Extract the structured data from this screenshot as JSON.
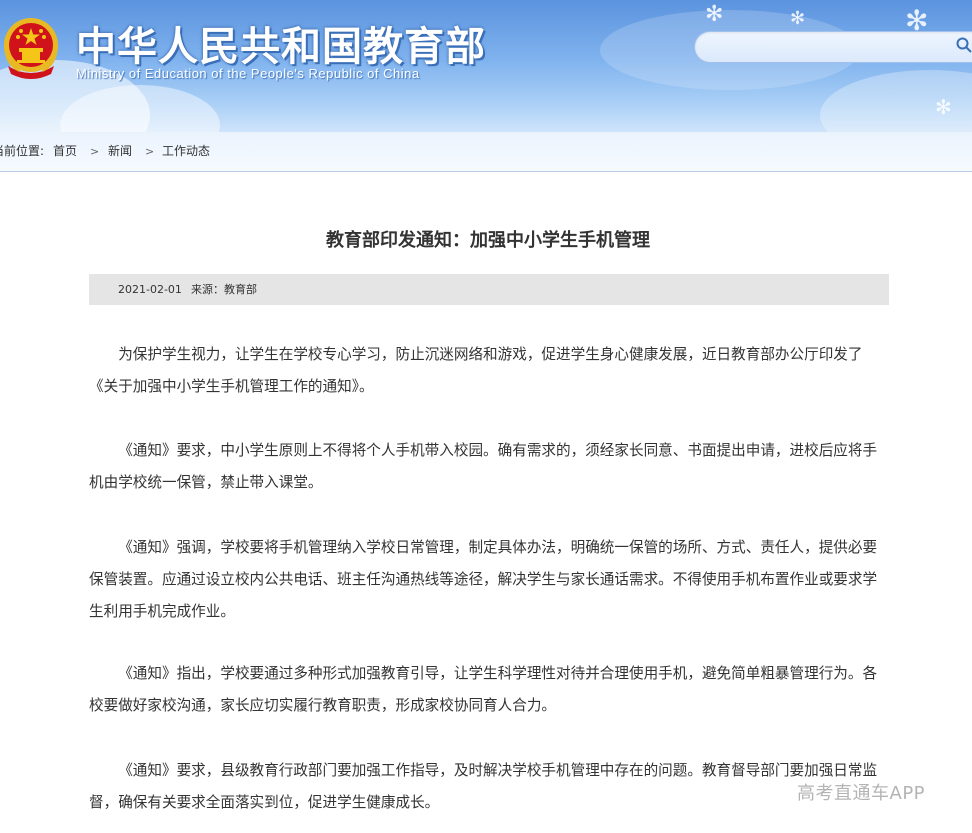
{
  "header": {
    "title": "中华人民共和国教育部",
    "subtitle": "Ministry of Education of the People's Republic of China",
    "emblem_icon": "national-emblem-icon",
    "search": {
      "placeholder": "",
      "icon": "search-icon"
    }
  },
  "breadcrumb": {
    "label": "当前位置:",
    "items": [
      "首页",
      "新闻",
      "工作动态"
    ],
    "separator": ">"
  },
  "article": {
    "title": "教育部印发通知：加强中小学生手机管理",
    "date": "2021-02-01",
    "source": "来源：教育部",
    "paragraphs": [
      "为保护学生视力，让学生在学校专心学习，防止沉迷网络和游戏，促进学生身心健康发展，近日教育部办公厅印发了《关于加强中小学生手机管理工作的通知》。",
      "《通知》要求，中小学生原则上不得将个人手机带入校园。确有需求的，须经家长同意、书面提出申请，进校后应将手机由学校统一保管，禁止带入课堂。",
      "《通知》强调，学校要将手机管理纳入学校日常管理，制定具体办法，明确统一保管的场所、方式、责任人，提供必要保管装置。应通过设立校内公共电话、班主任沟通热线等途径，解决学生与家长通话需求。不得使用手机布置作业或要求学生利用手机完成作业。",
      "《通知》指出，学校要通过多种形式加强教育引导，让学生科学理性对待并合理使用手机，避免简单粗暴管理行为。各校要做好家校沟通，家长应切实履行教育职责，形成家校协同育人合力。",
      "《通知》要求，县级教育行政部门要加强工作指导，及时解决学校手机管理中存在的问题。教育督导部门要加强日常监督，确保有关要求全面落实到位，促进学生健康成长。"
    ]
  },
  "watermark": "高考直通车APP",
  "colors": {
    "banner": "#5b93de",
    "meta_bar": "#e5e5e5",
    "text": "#333333"
  }
}
